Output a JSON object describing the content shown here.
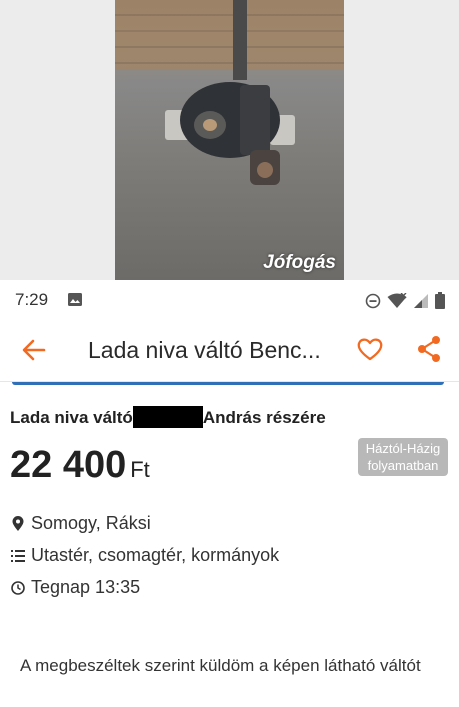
{
  "photo": {
    "watermark": "Jófogás"
  },
  "statusbar": {
    "time": "7:29"
  },
  "appbar": {
    "title": "Lada niva váltó Benc..."
  },
  "ad": {
    "title_prefix": "Lada niva váltó",
    "title_suffix": "András részére",
    "price": "22 400",
    "currency": "Ft",
    "badge_line1": "Háztól-Házig",
    "badge_line2": "folyamatban",
    "location": "Somogy, Ráksi",
    "category": "Utastér, csomagtér, kormányok",
    "posted": "Tegnap 13:35",
    "description": "A megbeszéltek szerint küldöm a képen látható váltót"
  },
  "colors": {
    "accent": "#f26a21",
    "tab_indicator": "#2e6fb7",
    "badge_bg": "#b8b8b8"
  },
  "icons": [
    "back-arrow-icon",
    "heart-icon",
    "share-icon",
    "location-pin-icon",
    "list-icon",
    "clock-icon",
    "image-icon",
    "dnd-icon",
    "wifi-icon",
    "signal-icon",
    "battery-icon"
  ]
}
